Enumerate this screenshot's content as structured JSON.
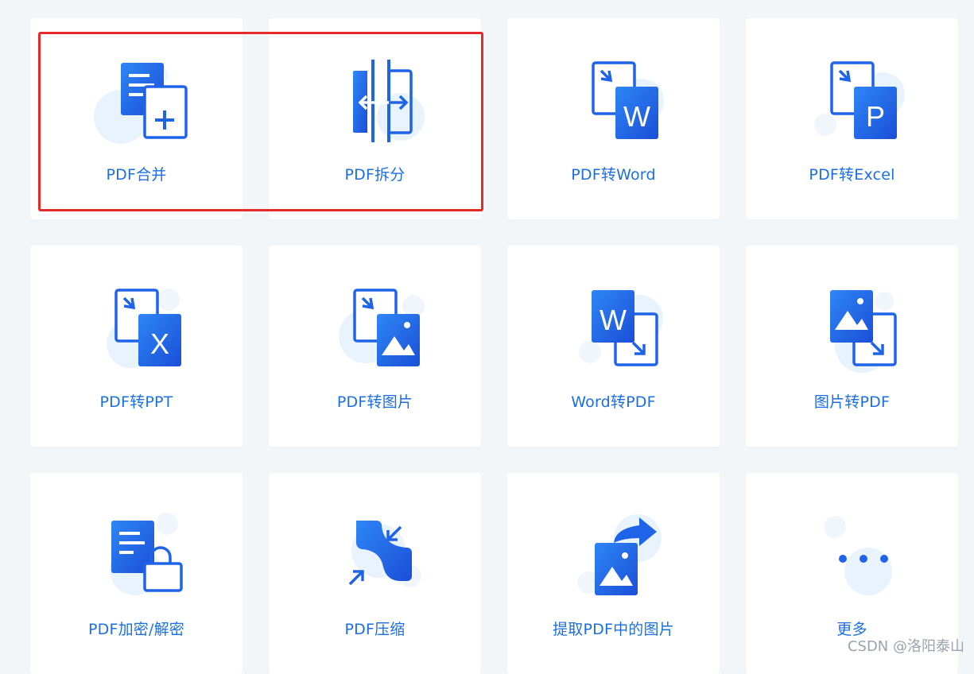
{
  "colors": {
    "accent": "#1c6fe0",
    "icon_dark": "#1d5de6",
    "icon_light": "#e8f3fd",
    "highlight": "#e52a2a",
    "background": "#f3f6f8"
  },
  "tools": [
    {
      "label": "PDF合并",
      "icon": "pdf-merge-icon"
    },
    {
      "label": "PDF拆分",
      "icon": "pdf-split-icon"
    },
    {
      "label": "PDF转Word",
      "icon": "pdf-to-word-icon",
      "glyph": "W"
    },
    {
      "label": "PDF转Excel",
      "icon": "pdf-to-excel-icon",
      "glyph": "P"
    },
    {
      "label": "PDF转PPT",
      "icon": "pdf-to-ppt-icon",
      "glyph": "X"
    },
    {
      "label": "PDF转图片",
      "icon": "pdf-to-image-icon"
    },
    {
      "label": "Word转PDF",
      "icon": "word-to-pdf-icon",
      "glyph": "W"
    },
    {
      "label": "图片转PDF",
      "icon": "image-to-pdf-icon"
    },
    {
      "label": "PDF加密/解密",
      "icon": "pdf-encrypt-icon"
    },
    {
      "label": "PDF压缩",
      "icon": "pdf-compress-icon"
    },
    {
      "label": "提取PDF中的图片",
      "icon": "extract-images-icon"
    },
    {
      "label": "更多",
      "icon": "more-dots-icon"
    }
  ],
  "watermark": "CSDN @洛阳泰山"
}
